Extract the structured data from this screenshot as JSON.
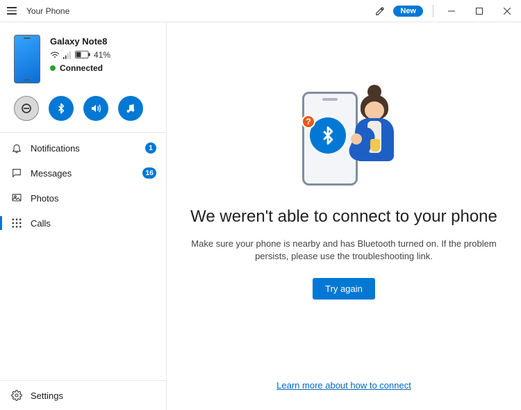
{
  "app": {
    "title": "Your Phone",
    "new_label": "New"
  },
  "device": {
    "name": "Galaxy Note8",
    "battery_percent": "41%",
    "status": "Connected"
  },
  "sidebar": {
    "items": [
      {
        "label": "Notifications",
        "badge": "1"
      },
      {
        "label": "Messages",
        "badge": "16"
      },
      {
        "label": "Photos"
      },
      {
        "label": "Calls"
      }
    ],
    "settings_label": "Settings"
  },
  "error": {
    "title": "We weren't able to connect to your phone",
    "body_line1": "Make sure your phone is nearby and has Bluetooth turned on. If the problem",
    "body_line2": "persists, please use the troubleshooting link.",
    "try_again": "Try again",
    "learn_more": "Learn more about how to connect",
    "question_mark": "?"
  }
}
